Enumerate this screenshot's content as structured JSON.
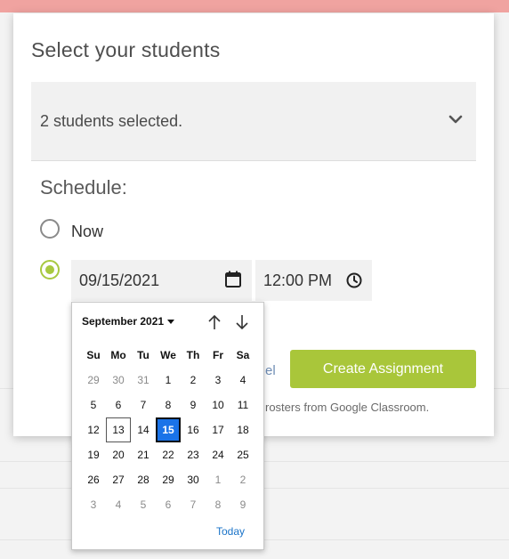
{
  "modal": {
    "title": "Select your students",
    "students_select_value": "2 students selected.",
    "schedule_label": "Schedule:",
    "now_label": "Now",
    "date_value": "09/15/2021",
    "time_value": "12:00 PM",
    "cancel_label": "el",
    "create_button_label": "Create Assignment",
    "roster_note": "rosters from Google Classroom."
  },
  "datepicker": {
    "month_label": "September 2021",
    "weekday_headers": [
      "Su",
      "Mo",
      "Tu",
      "We",
      "Th",
      "Fr",
      "Sa"
    ],
    "weeks": [
      [
        {
          "d": "29",
          "other": true
        },
        {
          "d": "30",
          "other": true
        },
        {
          "d": "31",
          "other": true
        },
        {
          "d": "1"
        },
        {
          "d": "2"
        },
        {
          "d": "3"
        },
        {
          "d": "4"
        }
      ],
      [
        {
          "d": "5"
        },
        {
          "d": "6"
        },
        {
          "d": "7"
        },
        {
          "d": "8"
        },
        {
          "d": "9"
        },
        {
          "d": "10"
        },
        {
          "d": "11"
        }
      ],
      [
        {
          "d": "12"
        },
        {
          "d": "13",
          "today": true
        },
        {
          "d": "14"
        },
        {
          "d": "15",
          "selected": true
        },
        {
          "d": "16"
        },
        {
          "d": "17"
        },
        {
          "d": "18"
        }
      ],
      [
        {
          "d": "19"
        },
        {
          "d": "20"
        },
        {
          "d": "21"
        },
        {
          "d": "22"
        },
        {
          "d": "23"
        },
        {
          "d": "24"
        },
        {
          "d": "25"
        }
      ],
      [
        {
          "d": "26"
        },
        {
          "d": "27"
        },
        {
          "d": "28"
        },
        {
          "d": "29"
        },
        {
          "d": "30"
        },
        {
          "d": "1",
          "other": true
        },
        {
          "d": "2",
          "other": true
        }
      ],
      [
        {
          "d": "3",
          "other": true
        },
        {
          "d": "4",
          "other": true
        },
        {
          "d": "5",
          "other": true
        },
        {
          "d": "6",
          "other": true
        },
        {
          "d": "7",
          "other": true
        },
        {
          "d": "8",
          "other": true
        },
        {
          "d": "9",
          "other": true
        }
      ]
    ],
    "today_label": "Today"
  },
  "colors": {
    "accent_green": "#a9c63a",
    "selected_day_blue": "#1a73e8",
    "top_bar_pink": "#f0a3a0"
  }
}
